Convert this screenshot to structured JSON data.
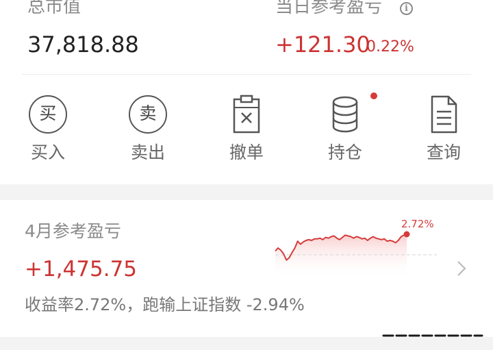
{
  "summary": {
    "total_label": "总市值",
    "total_value": "37,818.88",
    "daily_pnl_label": "当日参考盈亏",
    "daily_pnl_value": "+121.30",
    "daily_pnl_pct": "0.22%",
    "info_glyph": "i"
  },
  "actions": [
    {
      "label": "买入",
      "glyph": "买",
      "icon": "buy-circle-icon"
    },
    {
      "label": "卖出",
      "glyph": "卖",
      "icon": "sell-circle-icon"
    },
    {
      "label": "撤单",
      "icon": "cancel-order-icon"
    },
    {
      "label": "持仓",
      "icon": "database-stack-icon",
      "badge_dot": true
    },
    {
      "label": "查询",
      "icon": "document-icon"
    }
  ],
  "monthly": {
    "title": "4月参考盈亏",
    "value": "+1,475.75",
    "summary_line": "收益率2.72%，跑输上证指数 -2.94%",
    "peak_label": "2.72%"
  },
  "chart_data": {
    "type": "area",
    "x": [
      1,
      2,
      3,
      4,
      5,
      6,
      7,
      8,
      9,
      10,
      11,
      12,
      13,
      14,
      15,
      16,
      17,
      18,
      19,
      20,
      21,
      22,
      23,
      24,
      25,
      26,
      27,
      28,
      29,
      30,
      31,
      32,
      33,
      34,
      35,
      36,
      37,
      38,
      39,
      40,
      41,
      42,
      43,
      44,
      45,
      46,
      47,
      48
    ],
    "values": [
      0.5,
      0.9,
      0.6,
      0.1,
      -0.7,
      -0.4,
      0.3,
      0.9,
      1.8,
      1.4,
      1.7,
      1.9,
      2.0,
      1.9,
      2.1,
      2.1,
      2.2,
      2.0,
      2.3,
      2.2,
      2.4,
      2.5,
      2.2,
      2.0,
      2.3,
      2.6,
      2.5,
      2.4,
      2.2,
      2.4,
      2.3,
      2.1,
      2.2,
      1.9,
      2.2,
      2.4,
      2.2,
      2.1,
      2.0,
      2.1,
      1.8,
      1.9,
      1.8,
      1.6,
      1.9,
      2.4,
      2.6,
      2.72
    ],
    "baseline": 0,
    "last_point_label": "2.72%",
    "colors": {
      "line": "#d63a3a",
      "fill_top": "#f8c9c9",
      "baseline": "#dddddd"
    }
  },
  "colors": {
    "up_red": "#cc3333",
    "muted_text": "#8a8a8a",
    "section_gap": "#f3f3f3"
  }
}
